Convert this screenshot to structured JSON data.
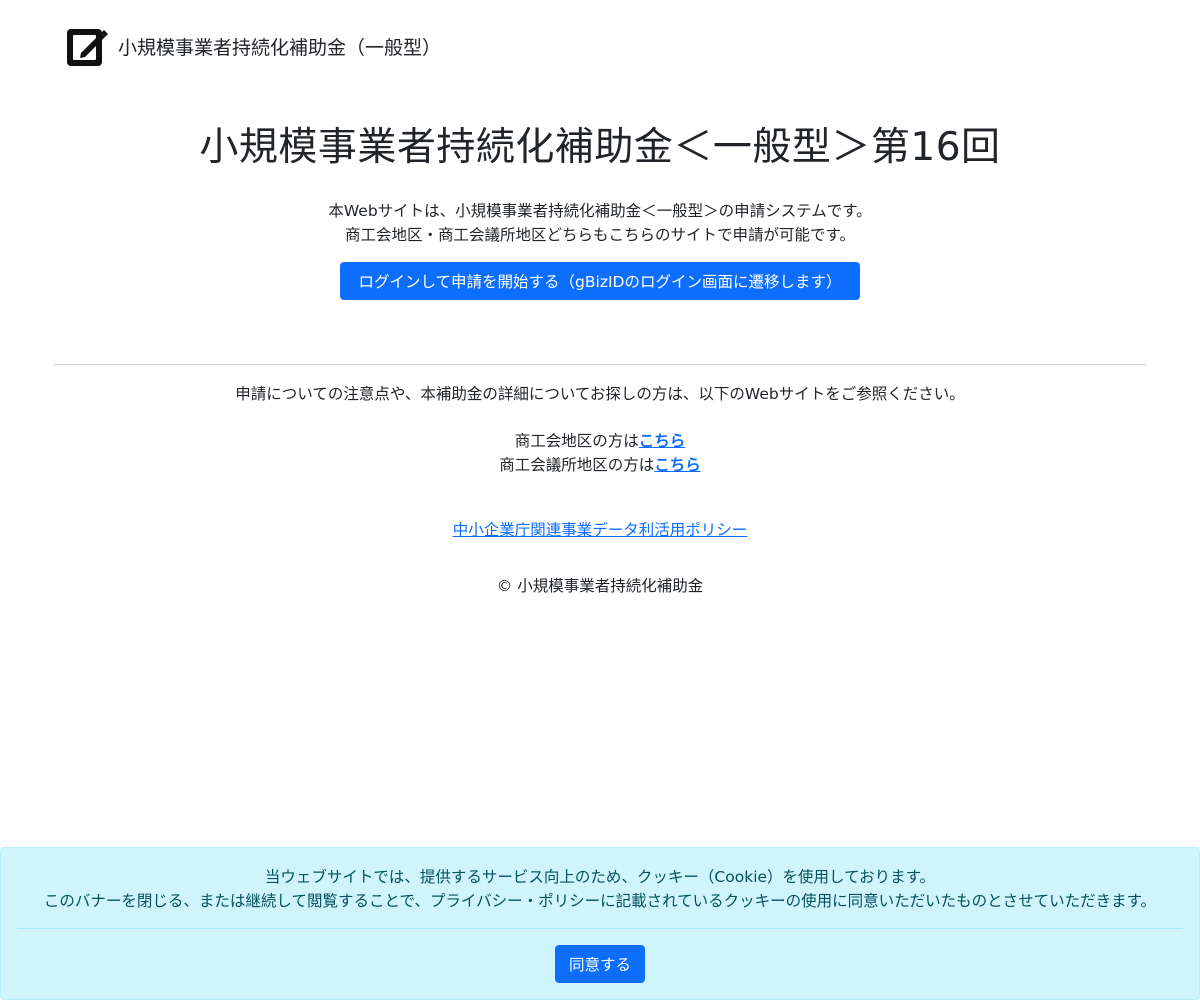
{
  "header": {
    "brand": "小規模事業者持続化補助金（一般型）"
  },
  "main": {
    "title": "小規模事業者持続化補助金＜一般型＞第16回",
    "intro_line1": "本Webサイトは、小規模事業者持続化補助金＜一般型＞の申請システムです。",
    "intro_line2": "商工会地区・商工会議所地区どちらもこちらのサイトで申請が可能です。",
    "login_button": "ログインして申請を開始する（gBizIDのログイン画面に遷移します）"
  },
  "footer": {
    "note": "申請についての注意点や、本補助金の詳細についてお探しの方は、以下のWebサイトをご参照ください。",
    "shokokai_prefix": "商工会地区の方は",
    "shokokai_link": "こちら",
    "shokokaigisho_prefix": "商工会議所地区の方は",
    "shokokaigisho_link": "こちら",
    "policy_link": "中小企業庁関連事業データ利活用ポリシー",
    "copyright": "© 小規模事業者持続化補助金"
  },
  "cookie": {
    "line1": "当ウェブサイトでは、提供するサービス向上のため、クッキー（Cookie）を使用しております。",
    "line2": "このバナーを閉じる、または継続して閲覧することで、プライバシー・ポリシーに記載されているクッキーの使用に同意いただいたものとさせていただきます。",
    "agree_button": "同意する"
  },
  "colors": {
    "primary": "#0d6efd",
    "banner_bg": "#cff4fc",
    "banner_text": "#055160"
  },
  "icons": {
    "logo": "pencil-square-icon"
  }
}
